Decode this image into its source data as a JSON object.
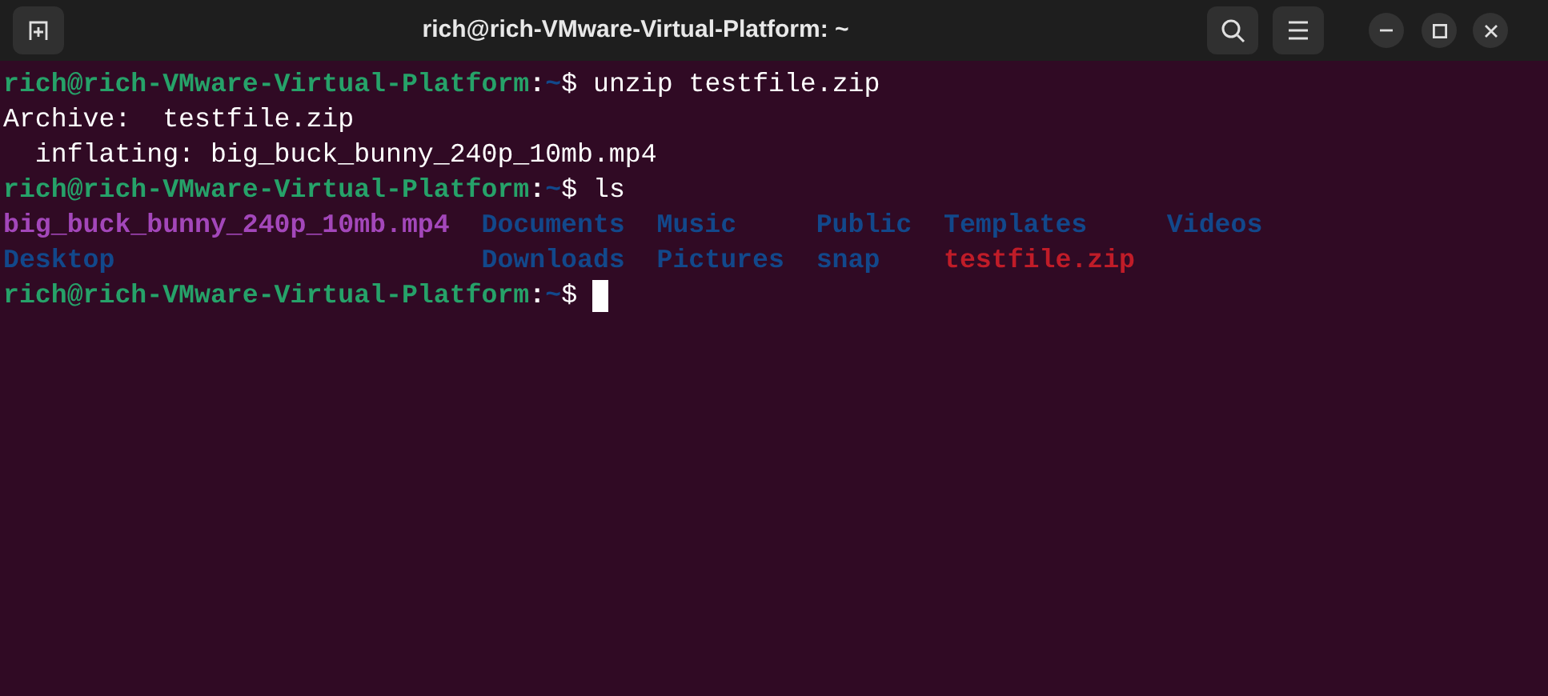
{
  "window": {
    "title": "rich@rich-VMware-Virtual-Platform: ~"
  },
  "terminal": {
    "lines": [
      {
        "kind": "prompt",
        "user_host": "rich@rich-VMware-Virtual-Platform",
        "separator": ":",
        "path": "~",
        "symbol": "$",
        "command": "unzip testfile.zip"
      },
      {
        "kind": "output",
        "text": "Archive:  testfile.zip"
      },
      {
        "kind": "output",
        "text": "  inflating: big_buck_bunny_240p_10mb.mp4"
      },
      {
        "kind": "prompt",
        "user_host": "rich@rich-VMware-Virtual-Platform",
        "separator": ":",
        "path": "~",
        "symbol": "$",
        "command": "ls"
      },
      {
        "kind": "listing",
        "columns": [
          [
            {
              "name": "big_buck_bunny_240p_10mb.mp4",
              "kind": "video"
            },
            {
              "name": "Desktop",
              "kind": "directory"
            }
          ],
          [
            {
              "name": "Documents",
              "kind": "directory"
            },
            {
              "name": "Downloads",
              "kind": "directory"
            }
          ],
          [
            {
              "name": "Music",
              "kind": "directory"
            },
            {
              "name": "Pictures",
              "kind": "directory"
            }
          ],
          [
            {
              "name": "Public",
              "kind": "directory"
            },
            {
              "name": "snap",
              "kind": "directory"
            }
          ],
          [
            {
              "name": "Templates",
              "kind": "directory"
            },
            {
              "name": "testfile.zip",
              "kind": "archive"
            }
          ],
          [
            {
              "name": "Videos",
              "kind": "directory"
            }
          ]
        ]
      },
      {
        "kind": "prompt",
        "user_host": "rich@rich-VMware-Virtual-Platform",
        "separator": ":",
        "path": "~",
        "symbol": "$",
        "cursor": true
      }
    ]
  }
}
